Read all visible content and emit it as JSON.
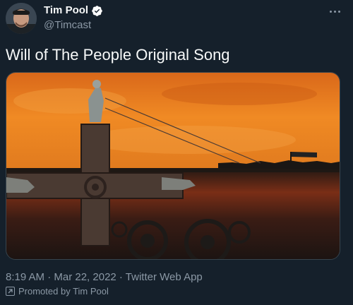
{
  "author": {
    "display_name": "Tim Pool",
    "handle": "@Timcast",
    "verified": true
  },
  "tweet": {
    "text": "Will of The People Original Song",
    "timestamp": "8:19 AM · Mar 22, 2022 · Twitter Web App",
    "promoted_label": "Promoted by Tim Pool"
  },
  "icons": {
    "verified": "verified-badge-icon",
    "more": "more-options-icon",
    "promoted": "promoted-arrow-icon"
  },
  "colors": {
    "background": "#15202b",
    "text_primary": "#f7f9f9",
    "text_secondary": "#8b98a5",
    "sky_orange": "#e8741c"
  }
}
